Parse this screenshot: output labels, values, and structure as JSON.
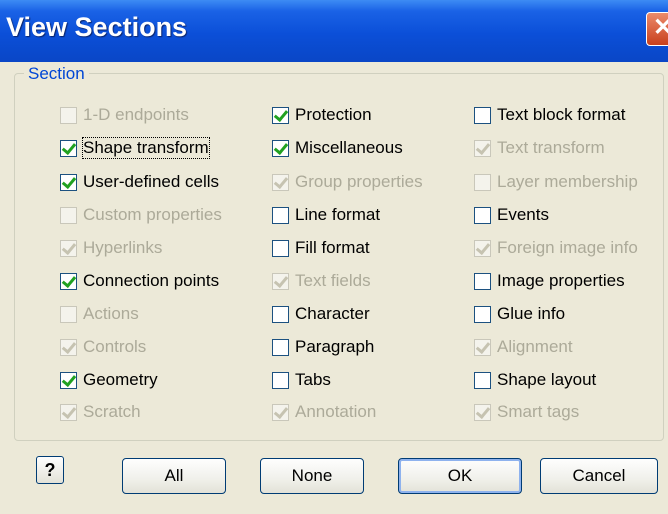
{
  "window": {
    "title": "View Sections",
    "close_label": "✕"
  },
  "group": {
    "label": "Section"
  },
  "checkboxes": [
    {
      "label": "1-D endpoints",
      "checked": false,
      "enabled": false
    },
    {
      "label": "Shape transform",
      "checked": true,
      "enabled": true
    },
    {
      "label": "User-defined cells",
      "checked": true,
      "enabled": true
    },
    {
      "label": "Custom properties",
      "checked": false,
      "enabled": false
    },
    {
      "label": "Hyperlinks",
      "checked": true,
      "enabled": false
    },
    {
      "label": "Connection points",
      "checked": true,
      "enabled": true
    },
    {
      "label": "Actions",
      "checked": false,
      "enabled": false
    },
    {
      "label": "Controls",
      "checked": true,
      "enabled": false
    },
    {
      "label": "Geometry",
      "checked": true,
      "enabled": true
    },
    {
      "label": "Scratch",
      "checked": true,
      "enabled": false
    },
    {
      "label": "Protection",
      "checked": true,
      "enabled": true
    },
    {
      "label": "Miscellaneous",
      "checked": true,
      "enabled": true
    },
    {
      "label": "Group properties",
      "checked": true,
      "enabled": false
    },
    {
      "label": "Line format",
      "checked": false,
      "enabled": true
    },
    {
      "label": "Fill format",
      "checked": false,
      "enabled": true
    },
    {
      "label": "Text fields",
      "checked": true,
      "enabled": false
    },
    {
      "label": "Character",
      "checked": false,
      "enabled": true
    },
    {
      "label": "Paragraph",
      "checked": false,
      "enabled": true
    },
    {
      "label": "Tabs",
      "checked": false,
      "enabled": true
    },
    {
      "label": "Annotation",
      "checked": true,
      "enabled": false
    },
    {
      "label": "Text block format",
      "checked": false,
      "enabled": true
    },
    {
      "label": "Text transform",
      "checked": true,
      "enabled": false
    },
    {
      "label": "Layer membership",
      "checked": false,
      "enabled": false
    },
    {
      "label": "Events",
      "checked": false,
      "enabled": true
    },
    {
      "label": "Foreign image info",
      "checked": true,
      "enabled": false
    },
    {
      "label": "Image properties",
      "checked": false,
      "enabled": true
    },
    {
      "label": "Glue info",
      "checked": false,
      "enabled": true
    },
    {
      "label": "Alignment",
      "checked": true,
      "enabled": false
    },
    {
      "label": "Shape layout",
      "checked": false,
      "enabled": true
    },
    {
      "label": "Smart tags",
      "checked": true,
      "enabled": false
    }
  ],
  "buttons": {
    "help": "?",
    "all": "All",
    "none": "None",
    "ok": "OK",
    "cancel": "Cancel"
  }
}
